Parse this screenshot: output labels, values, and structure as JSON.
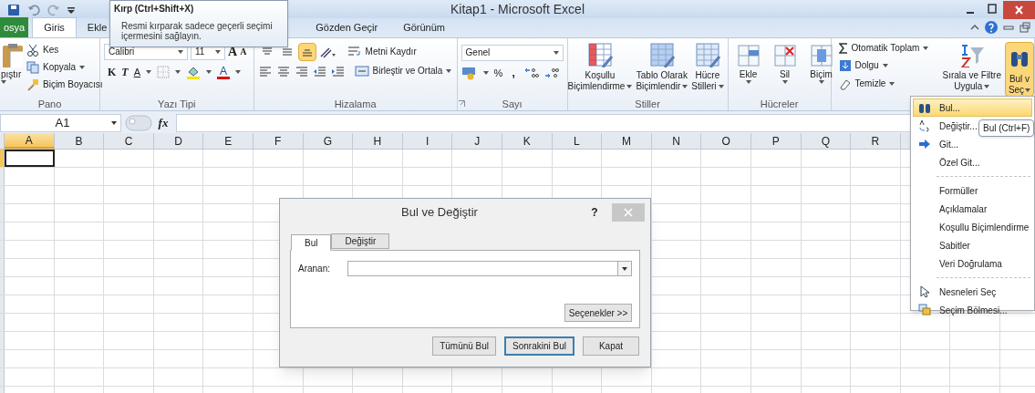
{
  "title_bar": {
    "title": "Kitap1 - Microsoft Excel"
  },
  "tabs": [
    {
      "label": "osya",
      "kind": "file",
      "selected": false
    },
    {
      "label": "Giris",
      "kind": "tab",
      "selected": true
    },
    {
      "label": "Ekle",
      "kind": "tab",
      "selected": false
    },
    {
      "label": "Gözden Geçir",
      "kind": "tab",
      "selected": false
    },
    {
      "label": "Görünüm",
      "kind": "tab",
      "selected": false
    }
  ],
  "tooltip": {
    "title": "Kırp (Ctrl+Shift+X)",
    "text": "Resmi kırparak sadece geçerli seçimi içermesini sağlayın."
  },
  "clipboard": {
    "label": "Pano",
    "paste": "pıştır",
    "cut": "Kes",
    "copy": "Kopyala",
    "format_painter": "Biçim Boyacısı"
  },
  "font": {
    "label": "Yazı Tipi",
    "name": "Calibri",
    "size": "11",
    "grow": "A",
    "shrink": "A",
    "bold": "K",
    "italic": "T",
    "underline": "A",
    "font_color": "A"
  },
  "alignment": {
    "label": "Hizalama",
    "vertical": [
      {
        "selected": false
      },
      {
        "selected": false
      },
      {
        "selected": true
      }
    ],
    "wrap": "Metni Kaydır",
    "merge": "Birleştir ve Ortala"
  },
  "number": {
    "label": "Sayı",
    "format": "Genel",
    "percent": "%",
    "comma": ","
  },
  "styles": {
    "label": "Stiller",
    "buttons": [
      {
        "lines": [
          "Koşullu",
          "Biçimlendirme"
        ]
      },
      {
        "lines": [
          "Tablo Olarak",
          "Biçimlendir"
        ]
      },
      {
        "lines": [
          "Hücre",
          "Stilleri"
        ]
      }
    ]
  },
  "cells": {
    "label": "Hücreler",
    "buttons": [
      "Ekle",
      "Sil",
      "Biçim"
    ]
  },
  "editing": {
    "autosum": "Otomatik Toplam",
    "fill": "Dolgu",
    "clear": "Temizle",
    "sort": [
      "Sırala ve Filtre",
      "Uygula"
    ],
    "find": {
      "lines": [
        "Bul v",
        "Seç"
      ],
      "selected": true
    }
  },
  "formula_bar": {
    "name_box": "A1",
    "fx": "fx"
  },
  "sheet": {
    "columns": [
      {
        "label": "A",
        "selected": true
      },
      {
        "label": "B",
        "selected": false
      },
      {
        "label": "C",
        "selected": false
      },
      {
        "label": "D",
        "selected": false
      },
      {
        "label": "E",
        "selected": false
      },
      {
        "label": "F",
        "selected": false
      },
      {
        "label": "G",
        "selected": false
      },
      {
        "label": "H",
        "selected": false
      },
      {
        "label": "I",
        "selected": false
      },
      {
        "label": "J",
        "selected": false
      },
      {
        "label": "K",
        "selected": false
      },
      {
        "label": "L",
        "selected": false
      },
      {
        "label": "M",
        "selected": false
      },
      {
        "label": "N",
        "selected": false
      },
      {
        "label": "O",
        "selected": false
      },
      {
        "label": "P",
        "selected": false
      },
      {
        "label": "Q",
        "selected": false
      },
      {
        "label": "R",
        "selected": false
      }
    ]
  },
  "find_menu": {
    "items": [
      {
        "kind": "item",
        "label": "Bul...",
        "selected": true
      },
      {
        "kind": "item",
        "label": "Değiştir...",
        "selected": false
      },
      {
        "kind": "item",
        "label": "Git...",
        "selected": false
      },
      {
        "kind": "item",
        "label": "Özel Git...",
        "selected": false
      },
      {
        "kind": "separator"
      },
      {
        "kind": "item",
        "label": "Formüller",
        "selected": false
      },
      {
        "kind": "item",
        "label": "Açıklamalar",
        "selected": false
      },
      {
        "kind": "item",
        "label": "Koşullu Biçimlendirme",
        "selected": false
      },
      {
        "kind": "item",
        "label": "Sabitler",
        "selected": false
      },
      {
        "kind": "item",
        "label": "Veri Doğrulama",
        "selected": false
      },
      {
        "kind": "separator"
      },
      {
        "kind": "item",
        "label": "Nesneleri Seç",
        "selected": false
      },
      {
        "kind": "item",
        "label": "Seçim Bölmesi...",
        "selected": false
      }
    ]
  },
  "menu_tooltip": {
    "text": "Bul (Ctrl+F)"
  },
  "dialog": {
    "title": "Bul ve Değiştir",
    "help": "?",
    "tabs": [
      {
        "label": "Bul",
        "selected": true
      },
      {
        "label": "Değiştir",
        "selected": false
      }
    ],
    "search_label": "Aranan:",
    "options_button": "Seçenekler >>",
    "buttons": [
      {
        "label": "Tümünü Bul",
        "focused": false
      },
      {
        "label": "Sonrakini Bul",
        "focused": true
      },
      {
        "label": "Kapat",
        "focused": false
      }
    ]
  }
}
